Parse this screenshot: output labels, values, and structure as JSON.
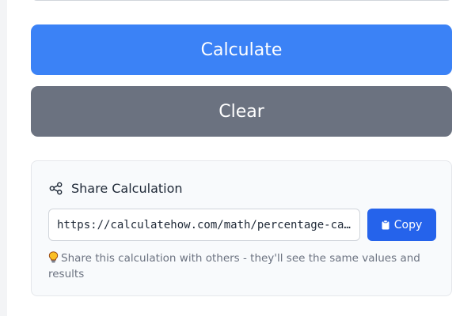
{
  "actions": {
    "calculate_label": "Calculate",
    "clear_label": "Clear"
  },
  "share": {
    "icon": "share-icon",
    "title": "Share Calculation",
    "url": "https://calculatehow.com/math/percentage-calculator",
    "copy_icon": "clipboard-icon",
    "copy_label": "Copy",
    "hint_icon": "lightbulb-icon",
    "hint_text": "Share this calculation with others - they'll see the same values and results"
  },
  "colors": {
    "calculate": "#3b82f6",
    "clear": "#6b7280",
    "copy": "#2563eb"
  }
}
